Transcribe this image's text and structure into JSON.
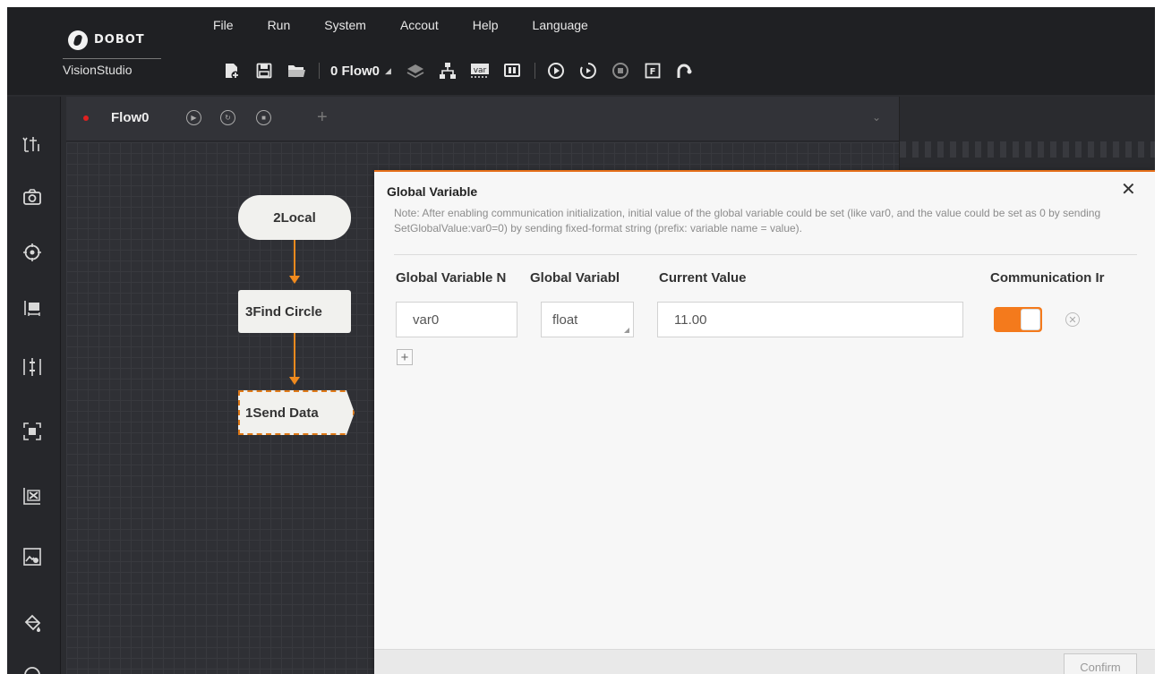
{
  "brand": {
    "name": "DOBOT",
    "subtitle": "VisionStudio"
  },
  "menu": [
    "File",
    "Run",
    "System",
    "Accout",
    "Help",
    "Language"
  ],
  "toolbar": {
    "flow_selector": "0 Flow0"
  },
  "flow_tab": {
    "label": "Flow0"
  },
  "nodes": {
    "local": "2Local",
    "find_circle": "3Find Circle",
    "send_data": "1Send Data"
  },
  "dialog": {
    "title": "Global Variable",
    "close": "✕",
    "note": "Note: After enabling communication initialization, initial value of the global variable could be set (like var0, and the value could be set as 0 by sending SetGlobalValue:var0=0) by sending fixed-format string (prefix: variable name = value).",
    "columns": {
      "name": "Global Variable N",
      "type": "Global Variabl",
      "value": "Current Value",
      "comm": "Communication Ir"
    },
    "row": {
      "name": "var0",
      "type": "float",
      "value": "11.00",
      "comm_enabled": true
    },
    "confirm": "Confirm"
  },
  "colors": {
    "accent": "#f47a1c",
    "connector": "#f08a1e",
    "canvas": "#2f3035"
  }
}
